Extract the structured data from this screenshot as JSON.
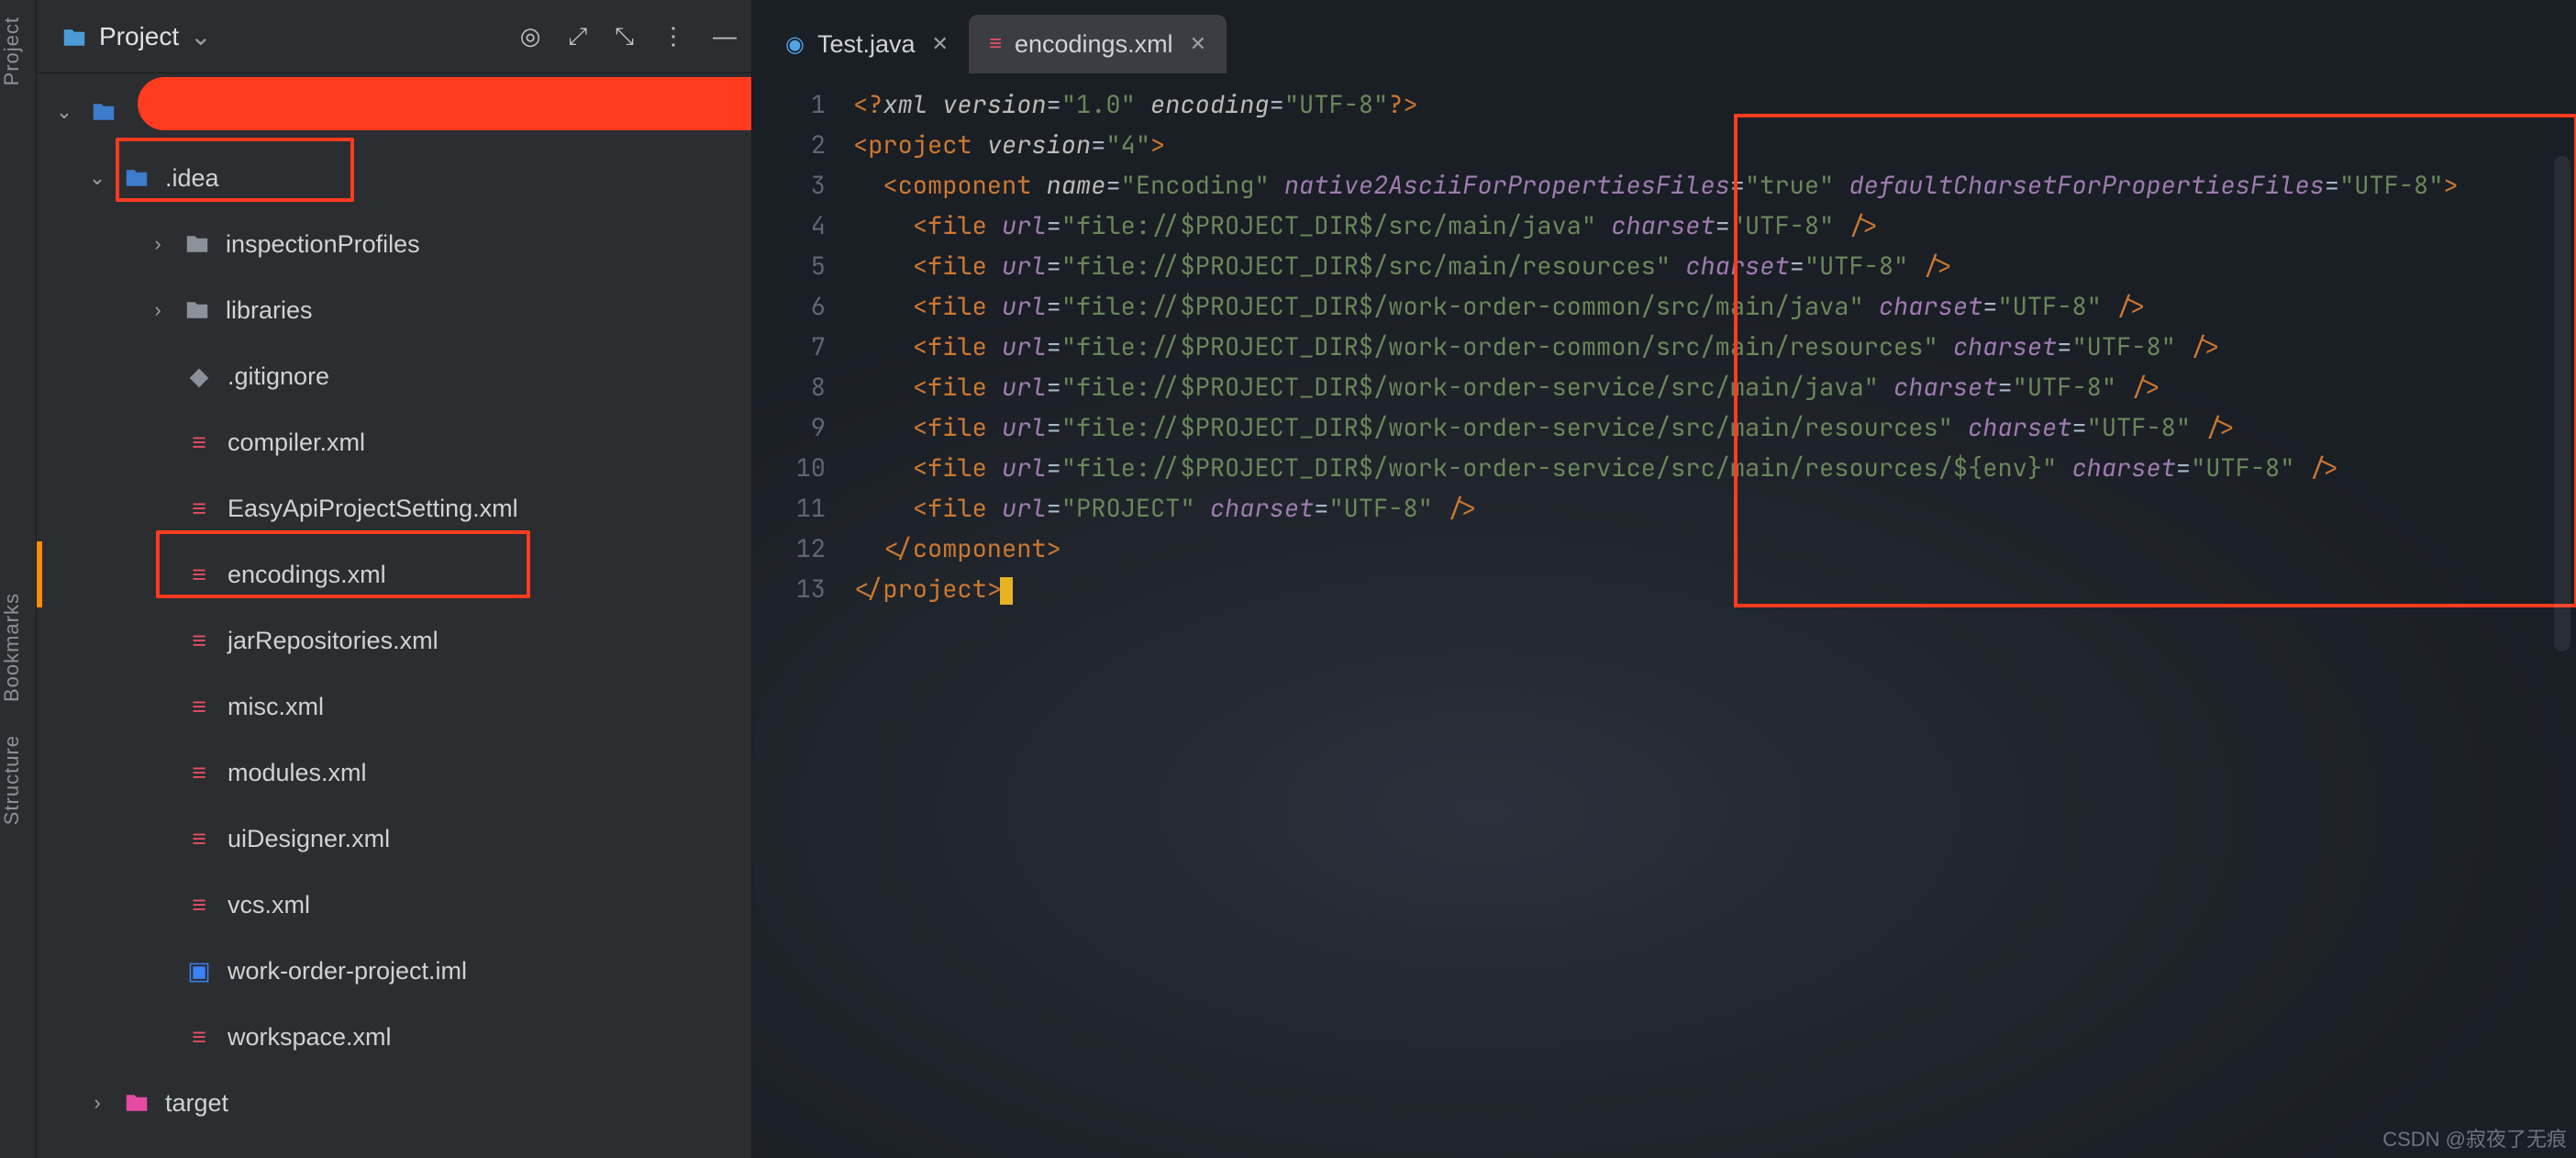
{
  "leftStrip": {
    "tabs": [
      "Project",
      "Bookmarks",
      "Structure"
    ]
  },
  "projectPanel": {
    "title": "Project",
    "header_icons": {
      "target": "target-icon",
      "expand": "expand-icon",
      "collapse": "collapse-icon",
      "more": "more-icon",
      "hide": "hide-icon"
    }
  },
  "tree": {
    "root": {
      "label": ""
    },
    "idea": {
      "label": ".idea"
    },
    "inspectionProfiles": {
      "label": "inspectionProfiles"
    },
    "libraries": {
      "label": "libraries"
    },
    "gitignore": {
      "label": ".gitignore"
    },
    "compiler": {
      "label": "compiler.xml"
    },
    "easyapi": {
      "label": "EasyApiProjectSetting.xml"
    },
    "encodings": {
      "label": "encodings.xml"
    },
    "jarRepositories": {
      "label": "jarRepositories.xml"
    },
    "misc": {
      "label": "misc.xml"
    },
    "modules": {
      "label": "modules.xml"
    },
    "uiDesigner": {
      "label": "uiDesigner.xml"
    },
    "vcs": {
      "label": "vcs.xml"
    },
    "workorderiml": {
      "label": "work-order-project.iml"
    },
    "workspace": {
      "label": "workspace.xml"
    },
    "target": {
      "label": "target"
    }
  },
  "tabs": {
    "test": {
      "label": "Test.java"
    },
    "encodings": {
      "label": "encodings.xml"
    }
  },
  "code": {
    "line_count": 13,
    "xml_header_pi": "xml",
    "xml_header_attrs": "version=\"1.0\" encoding=\"UTF-8\"",
    "project_version_attr": "version",
    "project_version_val": "\"4\"",
    "component_name_attr": "name",
    "component_name_val": "\"Encoding\"",
    "n2a_attr": "native2AsciiForPropertiesFiles",
    "n2a_val": "\"true\"",
    "defc_attr": "defaultCharsetForPropertiesFiles",
    "defc_val": "\"UTF-8\"",
    "files": [
      {
        "url": "\"file://$PROJECT_DIR$/src/main/java\"",
        "charset": "\"UTF-8\""
      },
      {
        "url": "\"file://$PROJECT_DIR$/src/main/resources\"",
        "charset": "\"UTF-8\""
      },
      {
        "url": "\"file://$PROJECT_DIR$/work-order-common/src/main/java\"",
        "charset": "\"UTF-8\""
      },
      {
        "url": "\"file://$PROJECT_DIR$/work-order-common/src/main/resources\"",
        "charset": "\"UTF-8\""
      },
      {
        "url": "\"file://$PROJECT_DIR$/work-order-service/src/main/java\"",
        "charset": "\"UTF-8\""
      },
      {
        "url": "\"file://$PROJECT_DIR$/work-order-service/src/main/resources\"",
        "charset": "\"UTF-8\""
      },
      {
        "url": "\"file://$PROJECT_DIR$/work-order-service/src/main/resources/${env}\"",
        "charset": "\"UTF-8\""
      },
      {
        "url": "\"PROJECT\"",
        "charset": "\"UTF-8\""
      }
    ],
    "tag_project": "project",
    "tag_component": "component",
    "tag_file": "file",
    "attr_url": "url",
    "attr_charset": "charset"
  },
  "watermark": "CSDN @寂夜了无痕"
}
